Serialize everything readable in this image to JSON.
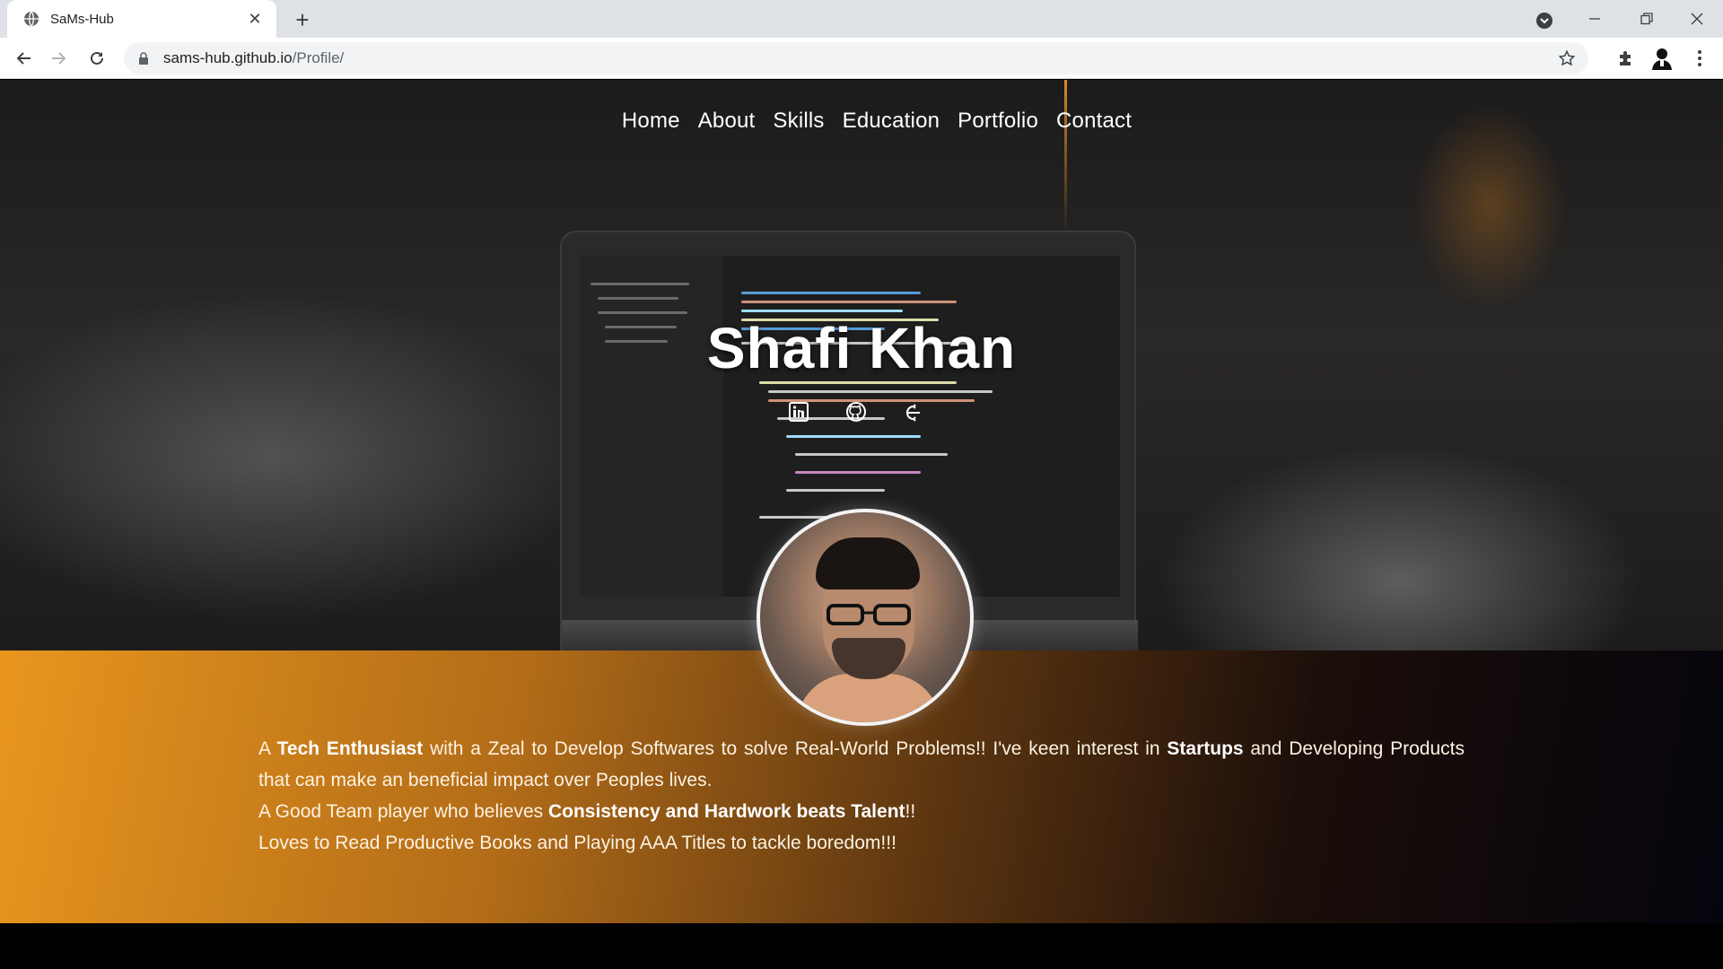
{
  "browser": {
    "tab_title": "SaMs-Hub",
    "url_host": "sams-hub.github.io",
    "url_path": "/Profile/"
  },
  "nav": {
    "items": [
      "Home",
      "About",
      "Skills",
      "Education",
      "Portfolio",
      "Contact"
    ]
  },
  "hero": {
    "name": "Shafi Khan",
    "social_icons": [
      "linkedin-icon",
      "github-icon",
      "hackerrank-icon"
    ]
  },
  "about": {
    "p1_a": "A ",
    "p1_b": "Tech Enthusiast",
    "p1_c": " with a Zeal to Develop Softwares to solve Real-World Problems!! I've keen interest in ",
    "p1_d": "Startups",
    "p1_e": " and Developing Products that can make an beneficial impact over Peoples lives.",
    "p2_a": "A Good Team player who believes ",
    "p2_b": "Consistency and Hardwork beats Talent",
    "p2_c": "!!",
    "p3": "Loves to Read Productive Books and Playing AAA Titles to tackle boredom!!!"
  },
  "colors": {
    "accent_orange": "#e8961e",
    "dark_end": "#05040c"
  }
}
